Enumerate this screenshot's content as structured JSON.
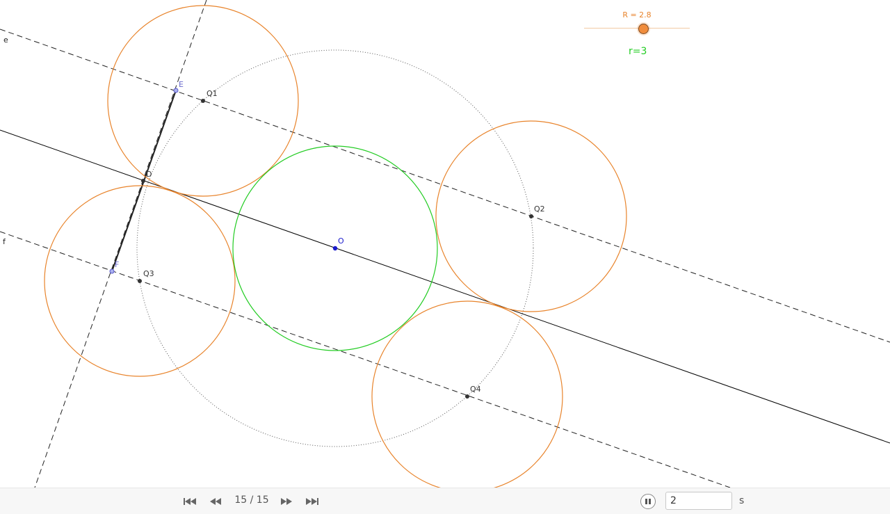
{
  "colors": {
    "orange": "#e8832a",
    "green": "#22cc22",
    "blue": "#1a1acc",
    "point": "#333333",
    "line": "#000000"
  },
  "slider": {
    "label": "R = 2.8",
    "value": 2.8
  },
  "radius_text": "r=3",
  "labels": {
    "E": "E",
    "F": "F",
    "D": "D",
    "O": "O",
    "Q1": "Q1",
    "Q2": "Q2",
    "Q3": "Q3",
    "Q4": "Q4",
    "e": "e",
    "f": "f"
  },
  "toolbar": {
    "first_icon": "first-step-icon",
    "prev_icon": "previous-step-icon",
    "step": "15 / 15",
    "next_icon": "next-step-icon",
    "last_icon": "last-step-icon",
    "pause_icon": "pause-icon",
    "speed_value": "2",
    "speed_unit": "s"
  }
}
